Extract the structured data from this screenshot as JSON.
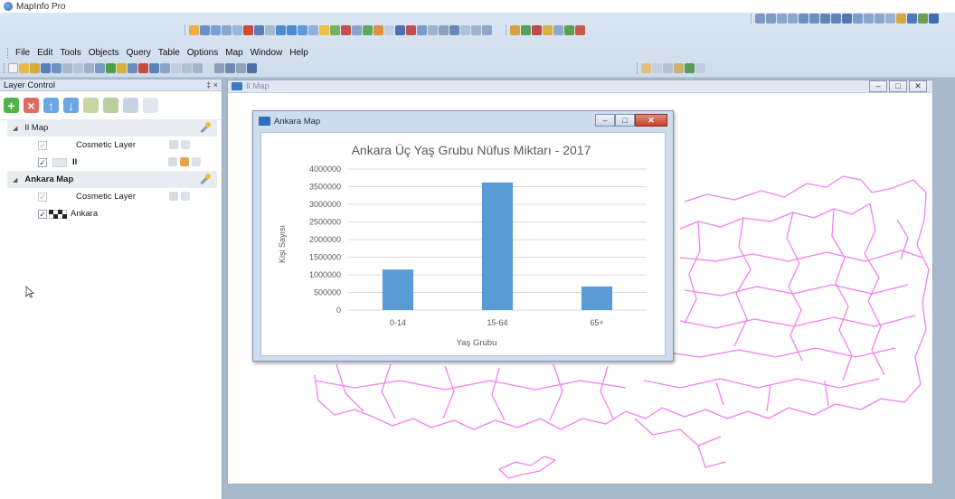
{
  "app": {
    "title": "MapInfo Pro"
  },
  "menu": [
    "File",
    "Edit",
    "Tools",
    "Objects",
    "Query",
    "Table",
    "Options",
    "Map",
    "Window",
    "Help"
  ],
  "layer_control": {
    "title": "Layer Control",
    "pin": "‡ ×",
    "maps": [
      {
        "name": "Il Map",
        "layers": [
          {
            "name": "Cosmetic Layer",
            "checked": true,
            "dim": true
          },
          {
            "name": "Il",
            "checked": true,
            "dim": false
          }
        ]
      },
      {
        "name": "Ankara Map",
        "layers": [
          {
            "name": "Cosmetic Layer",
            "checked": true,
            "dim": true
          },
          {
            "name": "Ankara",
            "checked": true,
            "dim": false
          }
        ]
      }
    ]
  },
  "map_window": {
    "title": "Il Map",
    "map_color": "#f080f0"
  },
  "chart_window": {
    "title": "Ankara Map"
  },
  "window_controls": {
    "minimize": "–",
    "restore": "□",
    "close": "✕"
  },
  "chart_data": {
    "type": "bar",
    "title": "Ankara Üç Yaş Grubu Nüfus Miktarı - 2017",
    "xlabel": "Yaş Grubu",
    "ylabel": "Kişi Sayısı",
    "categories": [
      "0-14",
      "15-64",
      "65+"
    ],
    "values": [
      1150000,
      3620000,
      670000
    ],
    "ylim": [
      0,
      4000000
    ],
    "yticks": [
      0,
      500000,
      1000000,
      1500000,
      2000000,
      2500000,
      3000000,
      3500000,
      4000000
    ],
    "grid": true,
    "bar_color": "#5b9bd5"
  }
}
